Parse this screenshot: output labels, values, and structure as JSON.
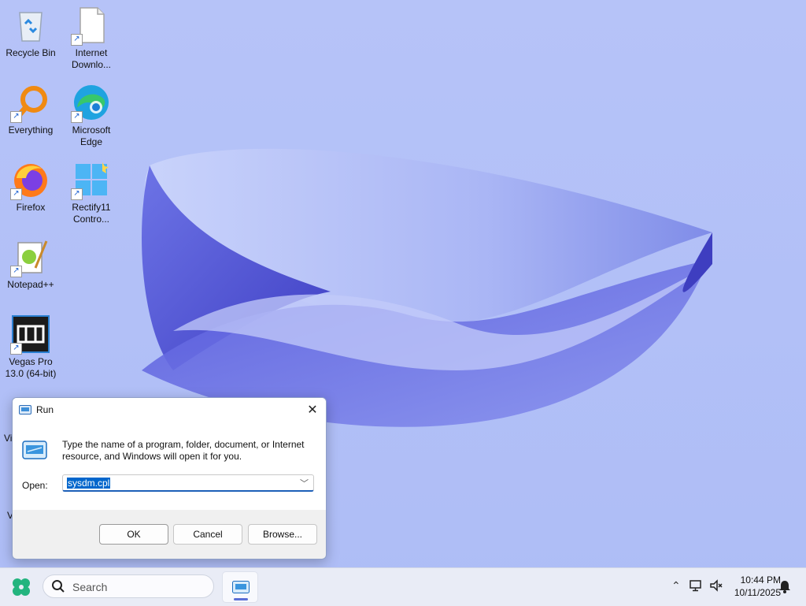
{
  "desktop": {
    "icons": [
      {
        "label": "Recycle Bin"
      },
      {
        "label": "Internet Downlo..."
      },
      {
        "label": "Everything"
      },
      {
        "label": "Microsoft Edge"
      },
      {
        "label": "Firefox"
      },
      {
        "label": "Rectify11 Contro..."
      },
      {
        "label": "Notepad++"
      },
      {
        "label": "Vegas Pro 13.0 (64-bit)"
      }
    ],
    "partial_labels": [
      "Vi",
      "V"
    ]
  },
  "run_dialog": {
    "title": "Run",
    "description": "Type the name of a program, folder, document, or Internet resource, and Windows will open it for you.",
    "open_label": "Open:",
    "open_value": "sysdm.cpl",
    "ok_label": "OK",
    "cancel_label": "Cancel",
    "browse_label": "Browse..."
  },
  "taskbar": {
    "search_placeholder": "Search",
    "time": "10:44 PM",
    "date": "10/11/2025"
  },
  "colors": {
    "desktop_bg": "#b6c3f8",
    "accent": "#0066cc",
    "taskbar_bg": "#e9ecf6"
  },
  "icons": [
    "recycle-bin-icon",
    "file-icon",
    "everything-icon",
    "edge-icon",
    "firefox-icon",
    "rectify-icon",
    "notepadpp-icon",
    "vegas-icon",
    "run-icon",
    "start-icon",
    "search-icon",
    "network-icon",
    "volume-icon",
    "bell-icon"
  ]
}
